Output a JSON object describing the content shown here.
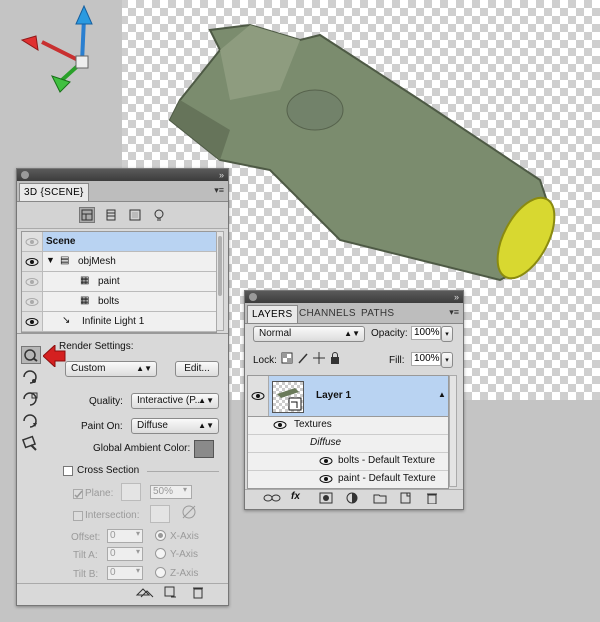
{
  "scene_panel": {
    "title": "3D {SCENE}",
    "items": [
      {
        "label": "Scene"
      },
      {
        "label": "objMesh"
      },
      {
        "label": "paint"
      },
      {
        "label": "bolts"
      },
      {
        "label": "Infinite Light 1"
      }
    ],
    "render_settings_label": "Render Settings:",
    "preset": "Custom",
    "edit_button": "Edit...",
    "quality_label": "Quality:",
    "quality_value": "Interactive (P...",
    "paint_on_label": "Paint On:",
    "paint_on_value": "Diffuse",
    "ambient_label": "Global Ambient Color:",
    "cross_section_label": "Cross Section",
    "plane_label": "Plane:",
    "plane_opacity": "50%",
    "intersection_label": "Intersection:",
    "offset_label": "Offset:",
    "offset_value": "0",
    "tilt_a_label": "Tilt A:",
    "tilt_a_value": "0",
    "tilt_b_label": "Tilt B:",
    "tilt_b_value": "0",
    "x_axis": "X-Axis",
    "y_axis": "Y-Axis",
    "z_axis": "Z-Axis"
  },
  "layers_panel": {
    "tabs": [
      "LAYERS",
      "CHANNELS",
      "PATHS"
    ],
    "blend_mode": "Normal",
    "opacity_label": "Opacity:",
    "opacity_value": "100%",
    "lock_label": "Lock:",
    "fill_label": "Fill:",
    "fill_value": "100%",
    "layer_name": "Layer 1",
    "textures_label": "Textures",
    "diffuse_label": "Diffuse",
    "texture_items": [
      "bolts - Default Texture",
      "paint - Default Texture"
    ],
    "fx_label": "fx"
  },
  "colors": {
    "selection": "#b9d3f2",
    "red_arrow": "#d42020",
    "bomb_body": "#7b8c6e",
    "bomb_tip": "#d8d830"
  }
}
